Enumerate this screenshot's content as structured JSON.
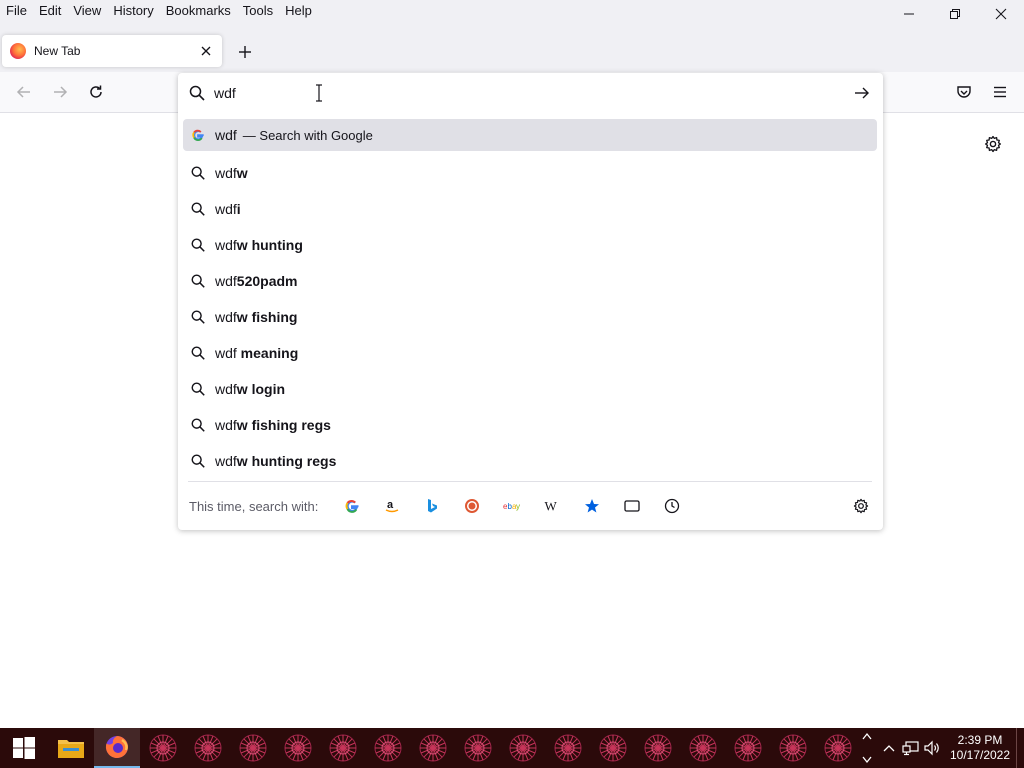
{
  "menubar": {
    "items": [
      "File",
      "Edit",
      "View",
      "History",
      "Bookmarks",
      "Tools",
      "Help"
    ]
  },
  "tab": {
    "title": "New Tab"
  },
  "urlbar": {
    "value": "wdf",
    "results": [
      {
        "typed": "wdf",
        "suffix": "",
        "action": "— Search with Google",
        "icon": "google-icon",
        "selected": true
      },
      {
        "typed": "wdf",
        "suffix": "w",
        "icon": "search-icon"
      },
      {
        "typed": "wdf",
        "suffix": "i",
        "icon": "search-icon"
      },
      {
        "typed": "wdf",
        "suffix": "w hunting",
        "icon": "search-icon"
      },
      {
        "typed": "wdf",
        "suffix": "520padm",
        "icon": "search-icon"
      },
      {
        "typed": "wdf",
        "suffix": "w fishing",
        "icon": "search-icon"
      },
      {
        "typed": "wdf",
        "suffix": " meaning",
        "icon": "search-icon"
      },
      {
        "typed": "wdf",
        "suffix": "w login",
        "icon": "search-icon"
      },
      {
        "typed": "wdf",
        "suffix": "w fishing regs",
        "icon": "search-icon"
      },
      {
        "typed": "wdf",
        "suffix": "w hunting regs",
        "icon": "search-icon"
      }
    ],
    "oneoff_label": "This time, search with:",
    "engines": [
      "google-icon",
      "amazon-icon",
      "bing-icon",
      "duckduckgo-icon",
      "ebay-icon",
      "wikipedia-icon",
      "bookmarks-star-icon",
      "tabs-icon",
      "history-icon"
    ]
  },
  "taskbar": {
    "time": "2:39 PM",
    "date": "10/17/2022"
  },
  "colors": {
    "accent": "#0060df",
    "taskbar": "#2b0a0a",
    "selected_row": "#e0e0e6"
  }
}
